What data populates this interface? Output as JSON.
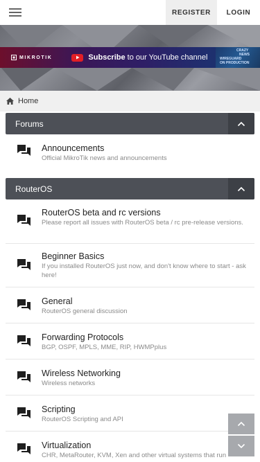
{
  "topbar": {
    "menu_icon": "hamburger-menu-icon",
    "register_label": "REGISTER",
    "login_label": "LOGIN"
  },
  "banner": {
    "brand": "MIKROTIK",
    "subscribe_bold": "Subscribe",
    "subscribe_rest": " to our YouTube channel",
    "deco_lines": [
      "CRAZY",
      "NEWS",
      "WIREGUARD",
      "ON PRODUCTION"
    ]
  },
  "breadcrumb": {
    "icon": "home-icon",
    "label": "Home"
  },
  "sections": [
    {
      "title": "Forums",
      "forums": [
        {
          "title": "Announcements",
          "description": "Official MikroTik news and announcements"
        }
      ]
    },
    {
      "title": "RouterOS",
      "forums": [
        {
          "title": "RouterOS beta and rc versions",
          "description": "Please report all issues with RouterOS beta / rc pre-release versions."
        },
        {
          "title": "Beginner Basics",
          "description": "If you installed RouterOS just now, and don't know where to start - ask here!"
        },
        {
          "title": "General",
          "description": "RouterOS general discussion"
        },
        {
          "title": "Forwarding Protocols",
          "description": "BGP, OSPF, MPLS, MME, RIP, HWMPplus"
        },
        {
          "title": "Wireless Networking",
          "description": "Wireless networks"
        },
        {
          "title": "Scripting",
          "description": "RouterOS Scripting and API"
        },
        {
          "title": "Virtualization",
          "description": "CHR, MetaRouter, KVM, Xen and other virtual systems that run"
        }
      ]
    }
  ],
  "colors": {
    "section_header": "#4d5057",
    "section_toggle": "#3d4046",
    "register_bg": "#eeeeee",
    "breadcrumb_bg": "#f0f0f0",
    "scroll_button": "#a7a9ad"
  },
  "icons": {
    "forum": "forum-chat-icon",
    "collapse": "chevron-up-icon",
    "scroll_up": "scroll-up-icon",
    "scroll_down": "scroll-down-icon"
  }
}
